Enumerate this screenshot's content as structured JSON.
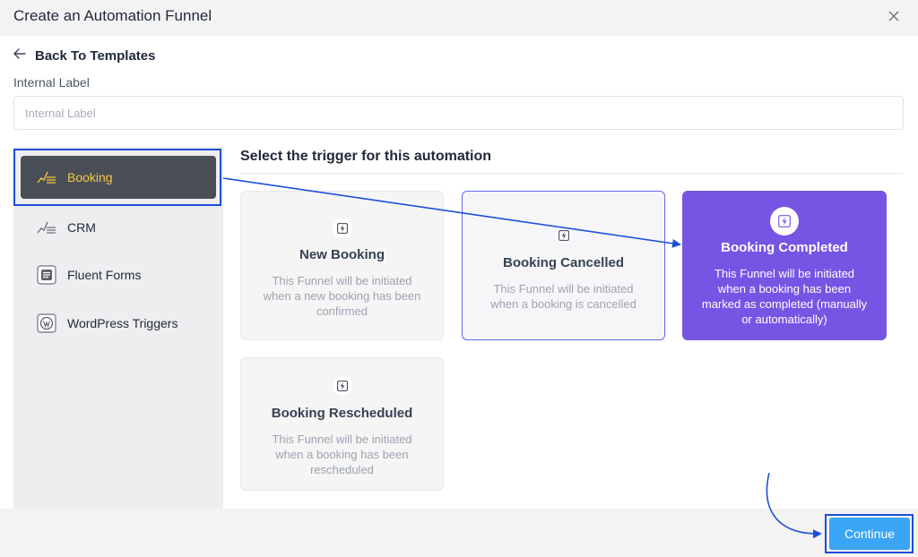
{
  "dialog": {
    "title": "Create an Automation Funnel",
    "back_label": "Back To Templates",
    "internal_label": {
      "label": "Internal Label",
      "placeholder": "Internal Label",
      "value": ""
    }
  },
  "sidebar": {
    "items": [
      {
        "label": "Booking",
        "icon": "chart-lines-icon",
        "active": true
      },
      {
        "label": "CRM",
        "icon": "chart-lines-icon",
        "active": false
      },
      {
        "label": "Fluent Forms",
        "icon": "fluent-forms-icon",
        "active": false
      },
      {
        "label": "WordPress Triggers",
        "icon": "wordpress-icon",
        "active": false
      }
    ]
  },
  "main": {
    "heading": "Select the trigger for this automation",
    "triggers": [
      {
        "title": "New Booking",
        "description": "This Funnel will be initiated when a new booking has been confirmed",
        "icon": "bolt-icon"
      },
      {
        "title": "Booking Cancelled",
        "description": "This Funnel will be initiated when a booking is cancelled",
        "icon": "bolt-icon"
      },
      {
        "title": "Booking Completed",
        "description": "This Funnel will be initiated when a booking has been marked as completed (manually or automatically)",
        "icon": "bolt-icon",
        "selected": true
      },
      {
        "title": "Booking Rescheduled",
        "description": "This Funnel will be initiated when a booking has been rescheduled",
        "icon": "bolt-icon"
      }
    ]
  },
  "footer": {
    "continue_label": "Continue"
  },
  "colors": {
    "selected_card": "#7655e5",
    "active_sidebar": "#4a4f57",
    "active_sidebar_text": "#f5c542",
    "continue_button": "#3aa4f5",
    "annotation": "#1d4ed8"
  }
}
